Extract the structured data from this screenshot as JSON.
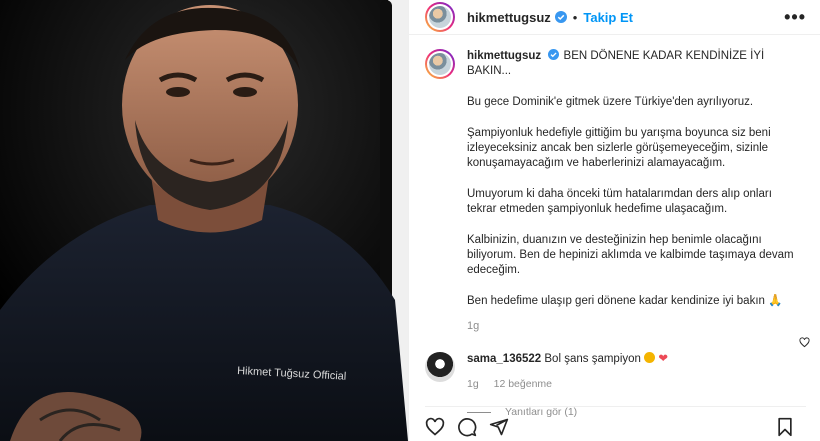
{
  "post": {
    "username": "hikmettugsuz",
    "follow_label": "Takip Et",
    "more_icon": "more-horizontal-icon",
    "photo": {
      "watermark_text": "Hikmet Tuğsuz Official"
    }
  },
  "caption": {
    "username": "hikmettugsuz",
    "headline": "BEN DÖNENE KADAR KENDİNİZE İYİ BAKIN...",
    "paragraphs": [
      "Bu gece Dominik'e gitmek üzere Türkiye'den ayrılıyoruz.",
      "Şampiyonluk hedefiyle gittiğim bu yarışma boyunca siz beni izleyeceksiniz ancak ben sizlerle görüşemeyeceğim, sizinle konuşamayacağım ve haberlerinizi alamayacağım.",
      "Umuyorum ki daha önceki tüm hatalarımdan ders alıp onları tekrar etmeden şampiyonluk hedefime ulaşacağım.",
      "Kalbinizin, duanızın ve desteğinizin hep benimle olacağını biliyorum. Ben de hepinizi aklımda ve kalbimde taşımaya devam edeceğim.",
      "Ben hedefime ulaşıp geri dönene kadar kendinize iyi bakın 🙏"
    ],
    "time": "1g"
  },
  "comment": {
    "username": "sama_136522",
    "text": "Bol şans şampiyon",
    "time": "1g",
    "likes": "12 beğenme",
    "replies_label": "Yanıtları gör (1)"
  },
  "icons": {
    "like": "heart-icon",
    "comment": "comment-icon",
    "share": "share-icon",
    "save": "bookmark-icon",
    "verified": "verified-badge-icon"
  },
  "colors": {
    "link_blue": "#0095f6",
    "verified_blue": "#3897f0",
    "heart_red": "#ed4956"
  }
}
